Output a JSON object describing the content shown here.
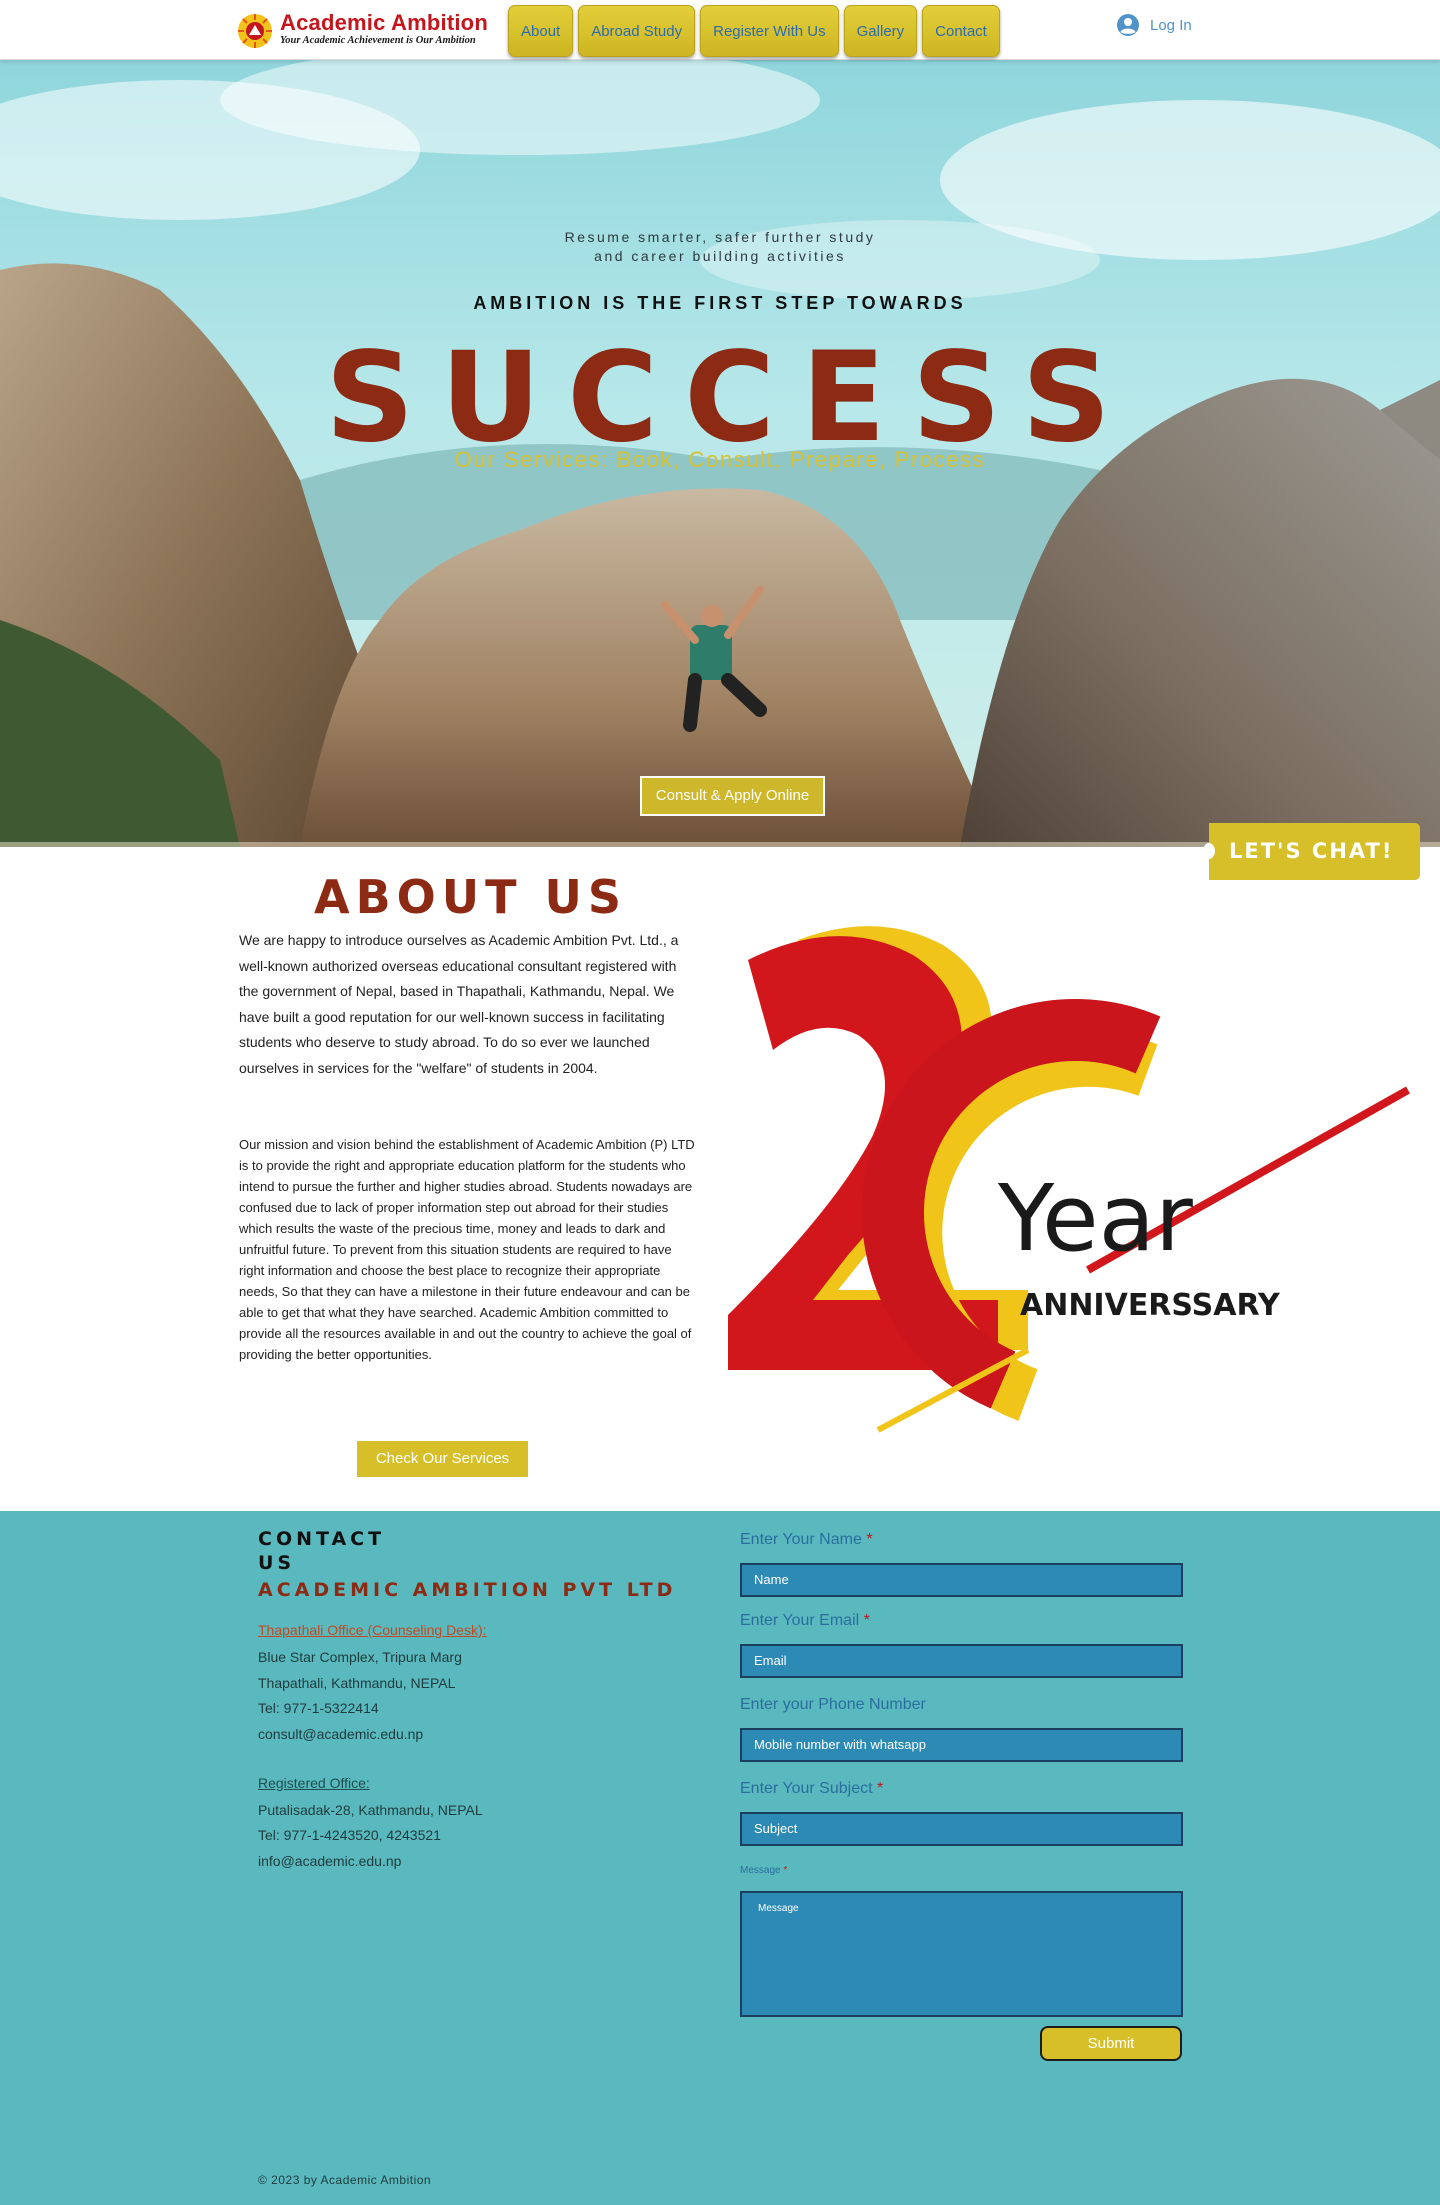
{
  "header": {
    "logo_title": "Academic Ambition",
    "logo_tagline": "Your Academic Achievement is Our Ambition",
    "nav": [
      "About",
      "Abroad Study",
      "Register With Us",
      "Gallery",
      "Contact"
    ],
    "login_label": "Log In"
  },
  "hero": {
    "subtitle_line1": "Resume smarter, safer further study",
    "subtitle_line2": "and career building activities",
    "kicker": "AMBITION IS THE FIRST STEP TOWARDS",
    "title": "SUCCESS",
    "services": "Our Services: Book, Consult, Prepare, Process",
    "cta_label": "Consult & Apply Online"
  },
  "chat": {
    "label": "LET'S CHAT!"
  },
  "about": {
    "title": "ABOUT US",
    "paragraph1": "We are happy to introduce ourselves as Academic Ambition Pvt. Ltd., a well-known authorized overseas educational consultant registered with the government of Nepal, based in Thapathali, Kathmandu, Nepal. We have built a good reputation for our well-known success in facilitating students who deserve to study abroad. To do so ever we launched ourselves in services for the \"welfare\" of students in 2004.",
    "paragraph2": "Our mission and vision behind the establishment of Academic Ambition (P) LTD is to provide the right and appropriate education platform for the students who intend to pursue the further and higher studies abroad. Students nowadays are confused due to lack of proper information step out abroad for their studies which results the waste of the precious time, money and leads   to dark and unfruitful future. To prevent from this situation students are required to have right information and choose the best place to recognize their appropriate needs, So that they can have a milestone in their future endeavour and can be able to get that what they have searched. Academic   Ambition committed to provide all the resources available in and out the country to achieve the goal of providing the better opportunities.",
    "services_button": "Check Our Services",
    "badge_word": "Year",
    "badge_sub": "ANNIVERSSARY"
  },
  "contact": {
    "heading": "CONTACT US",
    "company": "ACADEMIC AMBITION PVT LTD",
    "office_title": "Thapathali Office (Counseling Desk):",
    "office_lines": [
      "Blue Star Complex, Tripura Marg",
      "Thapathali, Kathmandu, NEPAL",
      "Tel: 977-1-5322414",
      "consult@academic.edu.np"
    ],
    "registered_title": "Registered Office:",
    "registered_lines": [
      "Putalisadak-28, Kathmandu, NEPAL",
      "Tel: 977-1-4243520, 4243521",
      "info@academic.edu.np"
    ],
    "form": {
      "name_label": "Enter Your Name",
      "name_placeholder": "Name",
      "email_label": "Enter Your Email",
      "email_placeholder": "Email",
      "phone_label": "Enter your Phone Number",
      "phone_placeholder": "Mobile number with whatsapp",
      "subject_label": "Enter Your Subject",
      "subject_placeholder": "Subject",
      "message_label": "Message",
      "message_placeholder": "Message",
      "required_mark": "*",
      "submit_label": "Submit"
    }
  },
  "footer": {
    "copyright": "© 2023 by Academic Ambition"
  },
  "colors": {
    "brand_red": "#8c2a14",
    "brand_yellow": "#d7bf2a",
    "contact_bg": "#59b9be",
    "input_bg": "#2c8ab5",
    "link_blue": "#4f93c8"
  },
  "icons": [
    "sun-logo-icon",
    "user-avatar-icon",
    "chat-bubble-icon"
  ]
}
